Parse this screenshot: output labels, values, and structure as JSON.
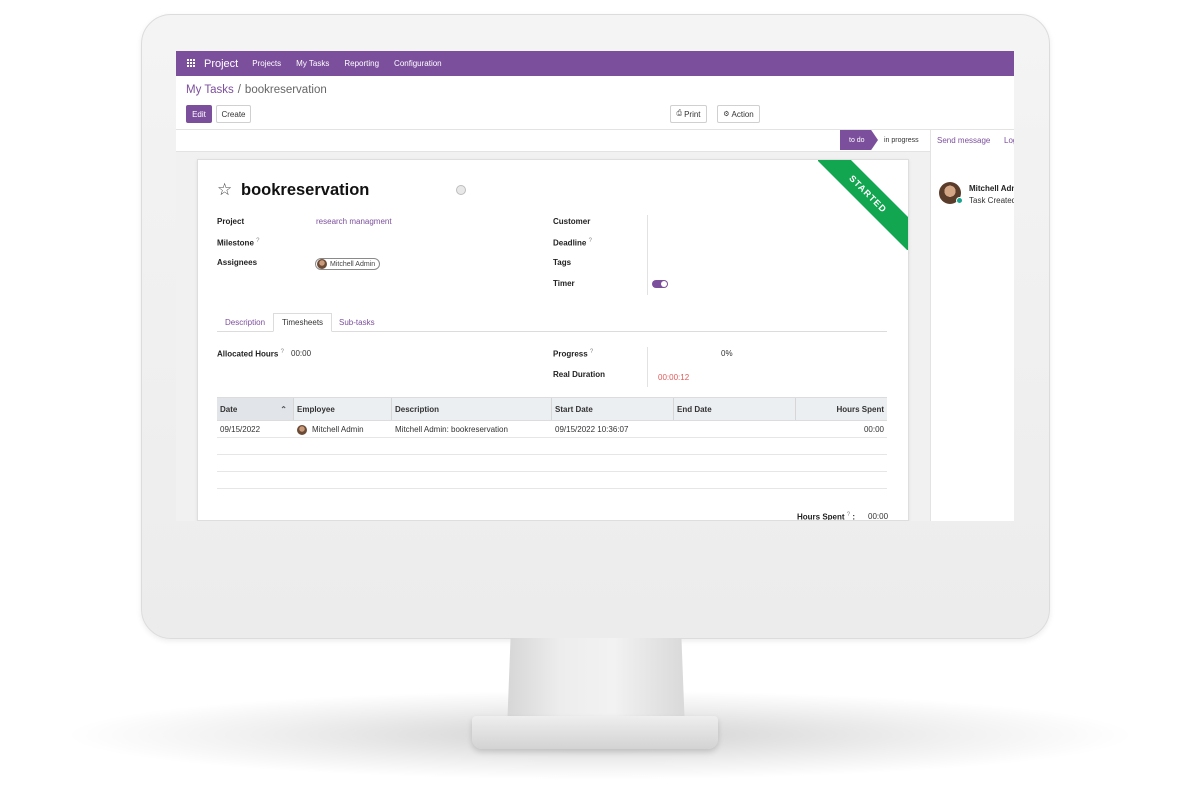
{
  "navbar": {
    "app_name": "Project",
    "items": [
      "Projects",
      "My Tasks",
      "Reporting",
      "Configuration"
    ]
  },
  "breadcrumb": {
    "parent": "My Tasks",
    "current": "bookreservation"
  },
  "buttons": {
    "edit": "Edit",
    "create": "Create",
    "print": "Print",
    "action": "Action"
  },
  "stages": {
    "active": "to do",
    "next": "in progress"
  },
  "ribbon": "STARTED",
  "task": {
    "title": "bookreservation",
    "fields": {
      "project_label": "Project",
      "project_value": "research managment",
      "milestone_label": "Milestone",
      "assignees_label": "Assignees",
      "assignee": "Mitchell Admin",
      "customer_label": "Customer",
      "deadline_label": "Deadline",
      "tags_label": "Tags",
      "timer_label": "Timer"
    },
    "help_mark": "?"
  },
  "tabs": [
    "Description",
    "Timesheets",
    "Sub-tasks"
  ],
  "timesheet": {
    "allocated_label": "Allocated Hours",
    "allocated_value": "00:00",
    "progress_label": "Progress",
    "progress_value": "0%",
    "real_duration_label": "Real Duration",
    "real_duration_value": "00:00:12",
    "columns": [
      "Date",
      "Employee",
      "Description",
      "Start Date",
      "End Date",
      "Hours Spent"
    ],
    "rows": [
      {
        "date": "09/15/2022",
        "employee": "Mitchell Admin",
        "description": "Mitchell Admin: bookreservation",
        "start": "09/15/2022 10:36:07",
        "end": "",
        "hours": "00:00"
      }
    ],
    "total_label": "Hours Spent",
    "total_value": "00:00"
  },
  "chatter": {
    "send_message": "Send message",
    "log_note": "Log note",
    "message": {
      "author": "Mitchell Admin",
      "text": "Task Created"
    }
  },
  "colors": {
    "brand": "#7c4f9d",
    "ribbon": "#13a650",
    "timer_text": "#e05a5a"
  }
}
